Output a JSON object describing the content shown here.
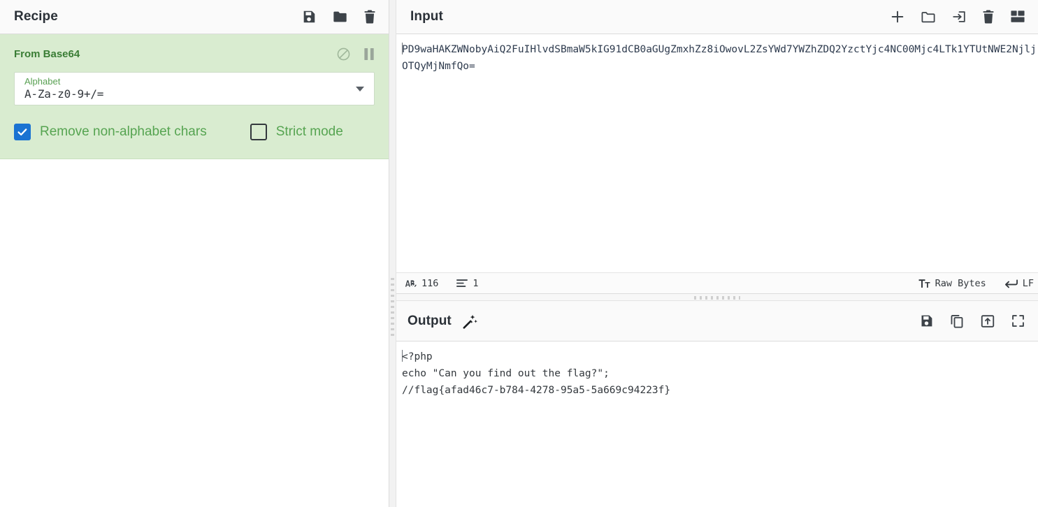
{
  "recipe": {
    "title": "Recipe",
    "header_icons": [
      {
        "name": "save-recipe-icon",
        "label": "Save recipe"
      },
      {
        "name": "load-recipe-icon",
        "label": "Load recipe"
      },
      {
        "name": "clear-recipe-icon",
        "label": "Clear recipe"
      }
    ],
    "operations": [
      {
        "name": "From Base64",
        "disable_label": "Disable operation",
        "pause_label": "Set breakpoint",
        "arg_label": "Alphabet",
        "arg_value": "A-Za-z0-9+/=",
        "checkbox_1_label": "Remove non-alphabet chars",
        "checkbox_1_checked": "true",
        "checkbox_2_label": "Strict mode",
        "checkbox_2_checked": "false"
      }
    ]
  },
  "input": {
    "title": "Input",
    "header_icons": [
      {
        "name": "add-input-tab-icon",
        "label": "Add a new input tab"
      },
      {
        "name": "open-folder-icon",
        "label": "Open folder as input"
      },
      {
        "name": "open-file-icon",
        "label": "Open file as input"
      },
      {
        "name": "clear-input-icon",
        "label": "Clear input and output"
      },
      {
        "name": "reset-pane-layout-icon",
        "label": "Reset pane layout"
      }
    ],
    "text": "PD9waHAKZWNobyAiQ2FuIHlvdSBmaW5kIG91dCB0aGUgZmxhZz8iOwovL2ZsYWd7YWZhZDQ2YzctYjc4NC00Mjc4LTk1YTUtNWE2NjljOTQyMjNmfQo=",
    "status": {
      "length_icon": "abc-icon",
      "length": "116",
      "lines_icon": "lines-icon",
      "lines": "1",
      "encoding_icon": "font-icon",
      "encoding": "Raw Bytes",
      "line_ending_icon": "return-arrow-icon",
      "line_ending": "LF"
    }
  },
  "output": {
    "title": "Output",
    "magic_icon_label": "magic-wand-icon",
    "header_icons": [
      {
        "name": "save-output-icon",
        "label": "Save output to file"
      },
      {
        "name": "copy-output-icon",
        "label": "Copy raw output to the clipboard"
      },
      {
        "name": "replace-input-icon",
        "label": "Replace input with output"
      },
      {
        "name": "maximise-output-icon",
        "label": "Maximise output pane"
      }
    ],
    "lines": [
      "<?php",
      "echo \"Can you find out the flag?\";",
      "//flag{afad46c7-b784-4278-95a5-5a669c94223f}"
    ]
  },
  "colors": {
    "operation_bg": "#d9ecd0",
    "operation_title": "#3a7d35",
    "checkbox_checked": "#1a73d2",
    "label_green": "#56a451",
    "text_dark": "#33383d"
  }
}
